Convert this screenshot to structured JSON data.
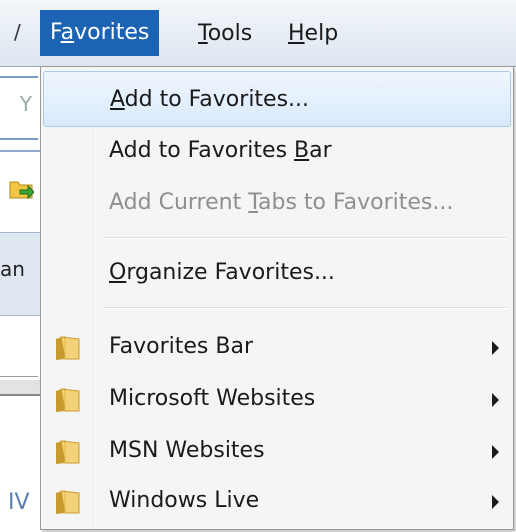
{
  "background": {
    "menu_fragment": "/",
    "address_fragment": "Y",
    "band_fragment": "an",
    "bottom_fragment": "IV"
  },
  "menubar": {
    "items": [
      {
        "pre": "F",
        "u": "a",
        "post": "vorites",
        "active": true
      },
      {
        "pre": "",
        "u": "T",
        "post": "ools",
        "active": false
      },
      {
        "pre": "",
        "u": "H",
        "post": "elp",
        "active": false
      }
    ]
  },
  "favorites_menu": {
    "items": [
      {
        "pre": "",
        "u": "A",
        "post": "dd to Favorites...",
        "state": "hover"
      },
      {
        "pre": "Add to Favorites ",
        "u": "B",
        "post": "ar",
        "state": "normal"
      },
      {
        "pre": "Add Current ",
        "u": "T",
        "post": "abs to Favorites...",
        "state": "disabled"
      },
      {
        "pre": "",
        "u": "O",
        "post": "rganize Favorites...",
        "state": "normal"
      },
      {
        "label": "Favorites Bar",
        "icon": "folder-icon",
        "submenu": true
      },
      {
        "label": "Microsoft Websites",
        "icon": "folder-icon",
        "submenu": true
      },
      {
        "label": "MSN Websites",
        "icon": "folder-icon",
        "submenu": true
      },
      {
        "label": "Windows Live",
        "icon": "folder-icon",
        "submenu": true
      }
    ]
  },
  "colors": {
    "menubar_active": "#1c63b4",
    "hover_border": "#aacbec",
    "disabled_text": "#8f8f8f"
  }
}
